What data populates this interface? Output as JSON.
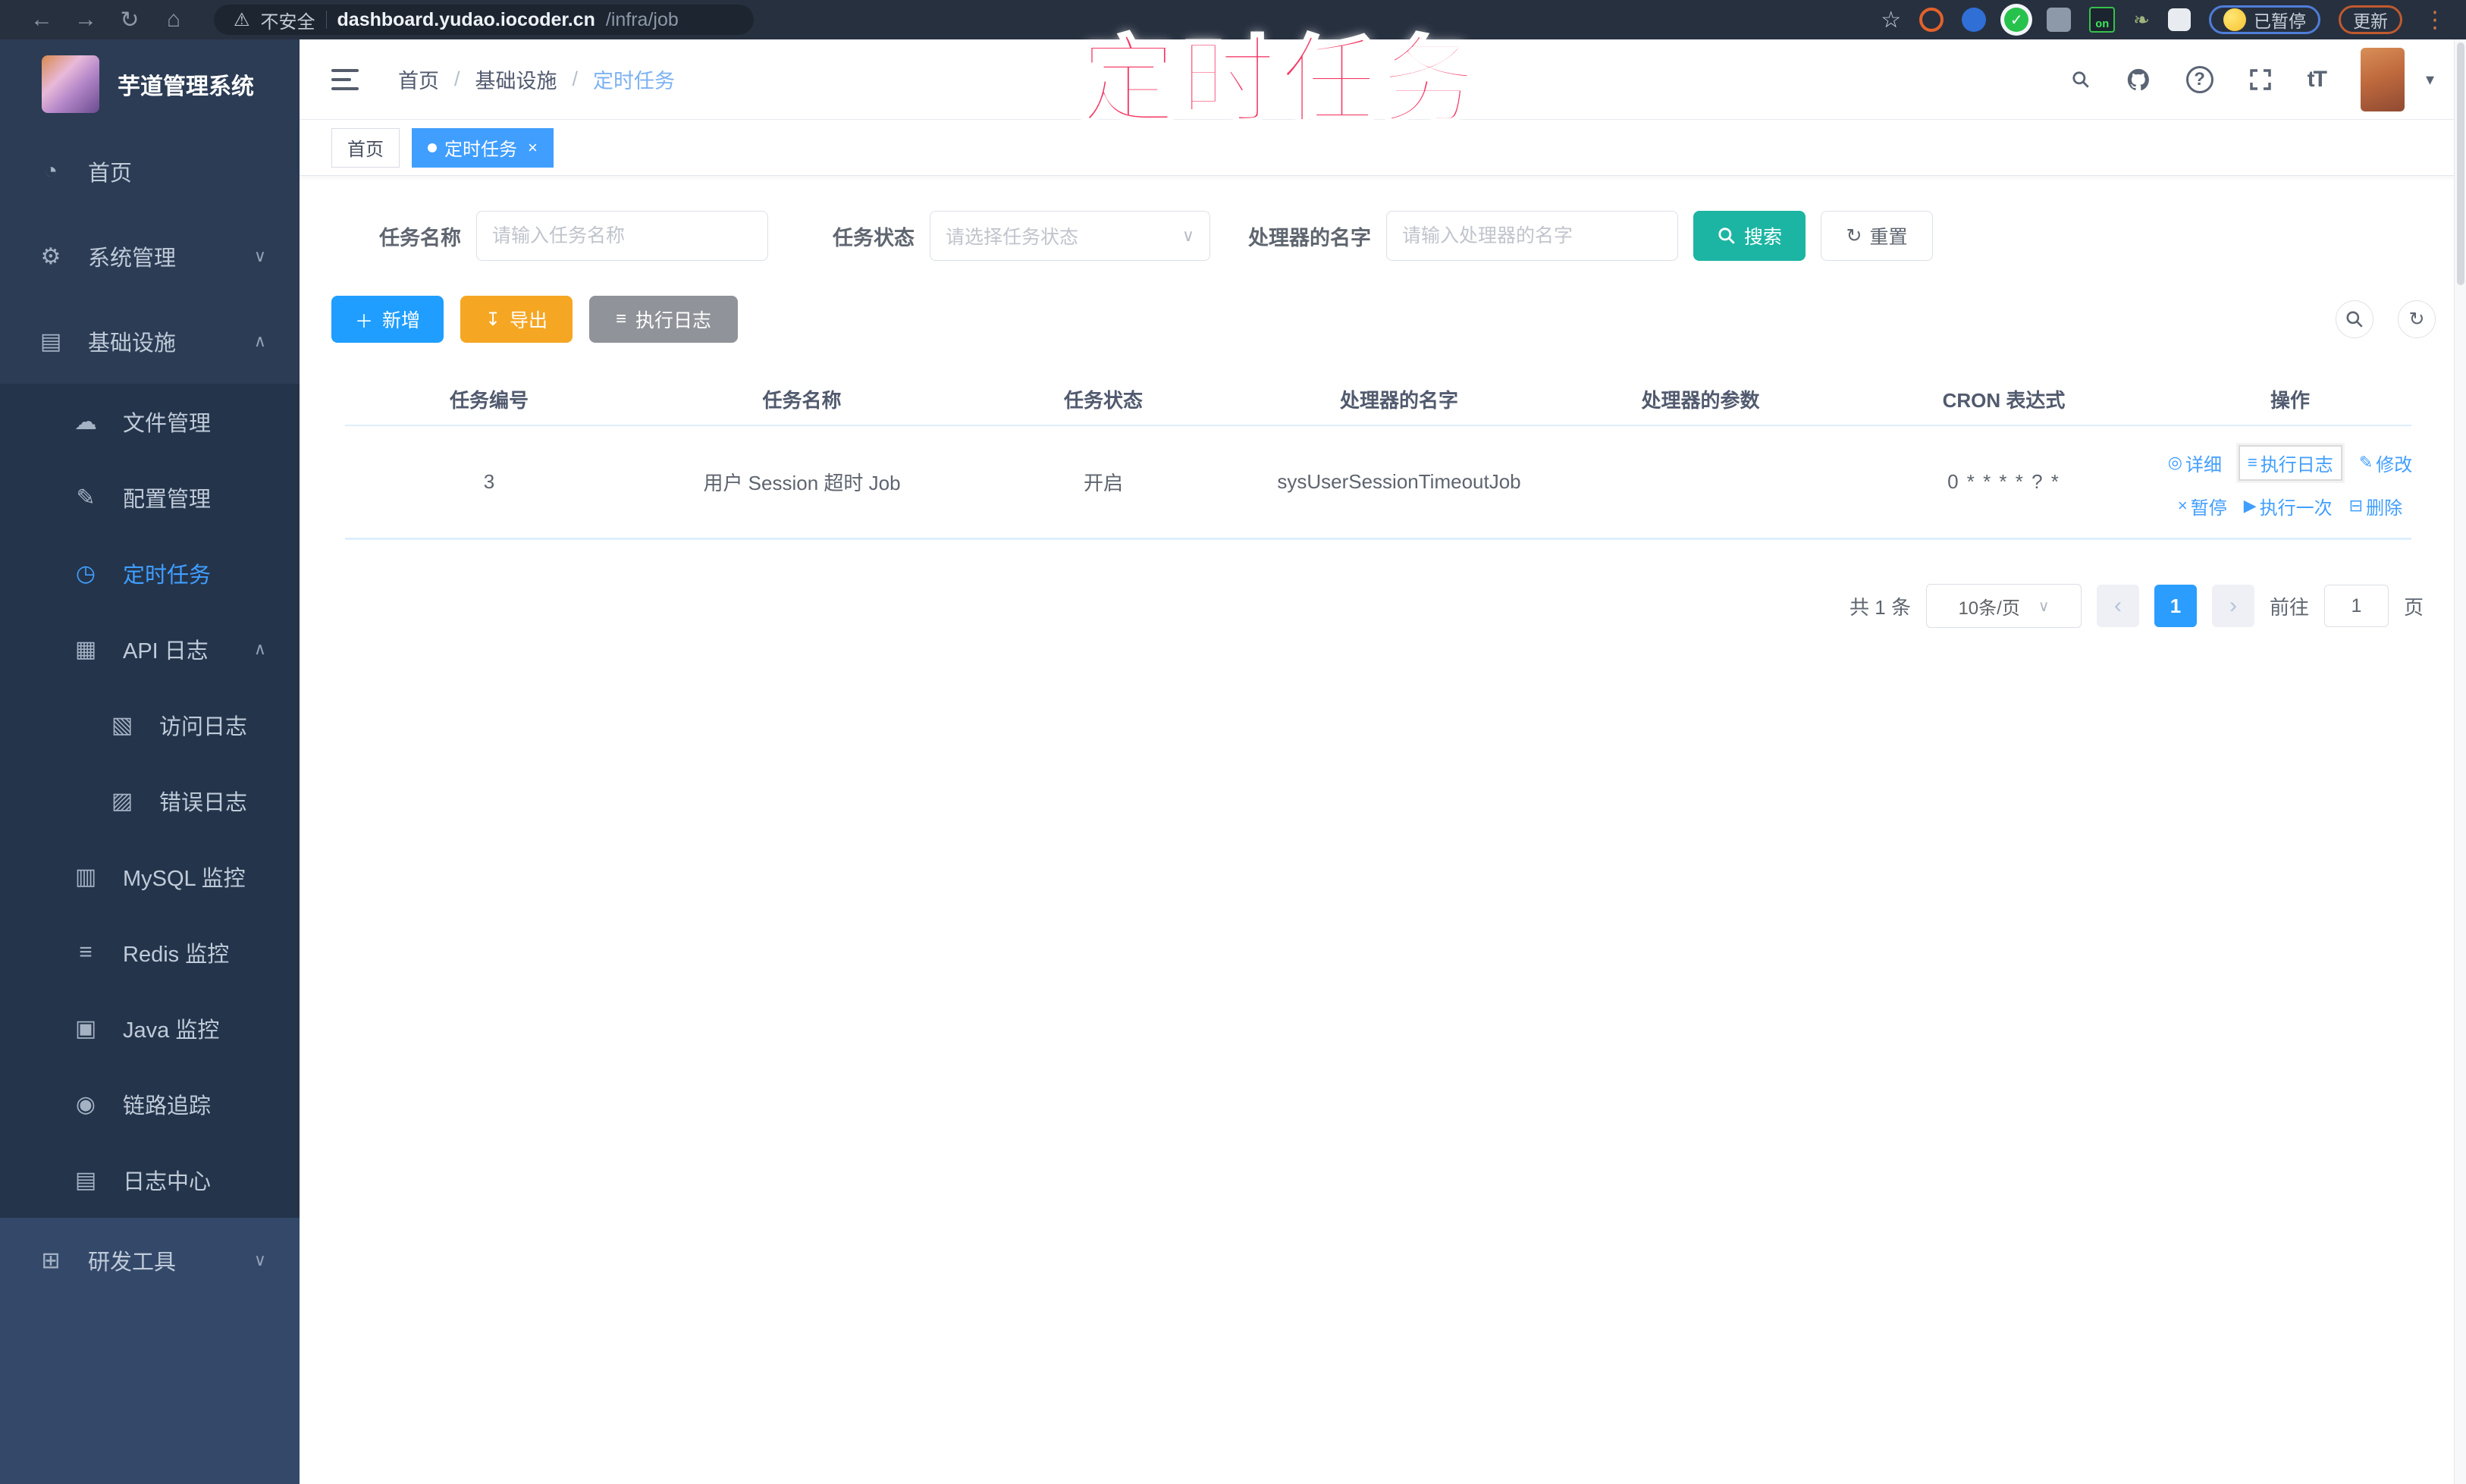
{
  "browser": {
    "security_label": "不安全",
    "url_host": "dashboard.yudao.iocoder.cn",
    "url_path": "/infra/job",
    "ext_on_badge": "on",
    "paused_label": "已暂停",
    "update_label": "更新"
  },
  "annotation": {
    "text": "定时任务"
  },
  "icons": {
    "back": "←",
    "forward": "→",
    "reload": "↻",
    "home": "⌂",
    "warning": "⚠",
    "star": "☆",
    "menu_dots": "⋮",
    "green_check": "✓",
    "caret": "▾",
    "help": "?",
    "font_size": "tT",
    "tab_dot": "●",
    "tab_close": "×",
    "chevron_down": "∨",
    "chevron_up": "∧",
    "add": "＋",
    "export": "↧",
    "list": "≡",
    "reset": "↻",
    "refresh": "↻",
    "prev": "‹",
    "next": "›",
    "detail": "◎",
    "edit": "✎",
    "pause": "×",
    "play": "▶",
    "delete": "⊟"
  },
  "sidebar": {
    "title": "芋道管理系统",
    "items": [
      {
        "label": "首页",
        "glyph": "◔"
      },
      {
        "label": "系统管理",
        "glyph": "⚙"
      },
      {
        "label": "基础设施",
        "glyph": "▤"
      },
      {
        "label": "文件管理",
        "glyph": "☁"
      },
      {
        "label": "配置管理",
        "glyph": "✎"
      },
      {
        "label": "定时任务",
        "glyph": "◷"
      },
      {
        "label": "API 日志",
        "glyph": "▦"
      },
      {
        "label": "访问日志",
        "glyph": "▧"
      },
      {
        "label": "错误日志",
        "glyph": "▨"
      },
      {
        "label": "MySQL 监控",
        "glyph": "▥"
      },
      {
        "label": "Redis 监控",
        "glyph": "≡"
      },
      {
        "label": "Java 监控",
        "glyph": "▣"
      },
      {
        "label": "链路追踪",
        "glyph": "◉"
      },
      {
        "label": "日志中心",
        "glyph": "▤"
      },
      {
        "label": "研发工具",
        "glyph": "⊞"
      }
    ]
  },
  "header": {
    "breadcrumb": [
      "首页",
      "基础设施",
      "定时任务"
    ],
    "separator": "/",
    "font_icon": "tT"
  },
  "tabs": {
    "home": "首页",
    "active": "定时任务"
  },
  "filters": {
    "name_label": "任务名称",
    "name_placeholder": "请输入任务名称",
    "status_label": "任务状态",
    "status_placeholder": "请选择任务状态",
    "handler_label": "处理器的名字",
    "handler_placeholder": "请输入处理器的名字",
    "search_label": "搜索",
    "reset_label": "重置"
  },
  "toolbar": {
    "add_label": "新增",
    "export_label": "导出",
    "exec_log_label": "执行日志"
  },
  "table": {
    "headers": [
      "任务编号",
      "任务名称",
      "任务状态",
      "处理器的名字",
      "处理器的参数",
      "CRON 表达式",
      "操作"
    ],
    "row": {
      "id": "3",
      "name": "用户 Session 超时 Job",
      "status": "开启",
      "handler": "sysUserSessionTimeoutJob",
      "param": "",
      "cron": "0 * * * * ? *"
    },
    "actions": {
      "detail": "详细",
      "exec_log": "执行日志",
      "edit": "修改",
      "pause": "暂停",
      "run_once": "执行一次",
      "delete": "删除"
    }
  },
  "pagination": {
    "total": "共 1 条",
    "size": "10条/页",
    "current": "1",
    "goto_label": "前往",
    "goto_value": "1",
    "unit_label": "页"
  }
}
